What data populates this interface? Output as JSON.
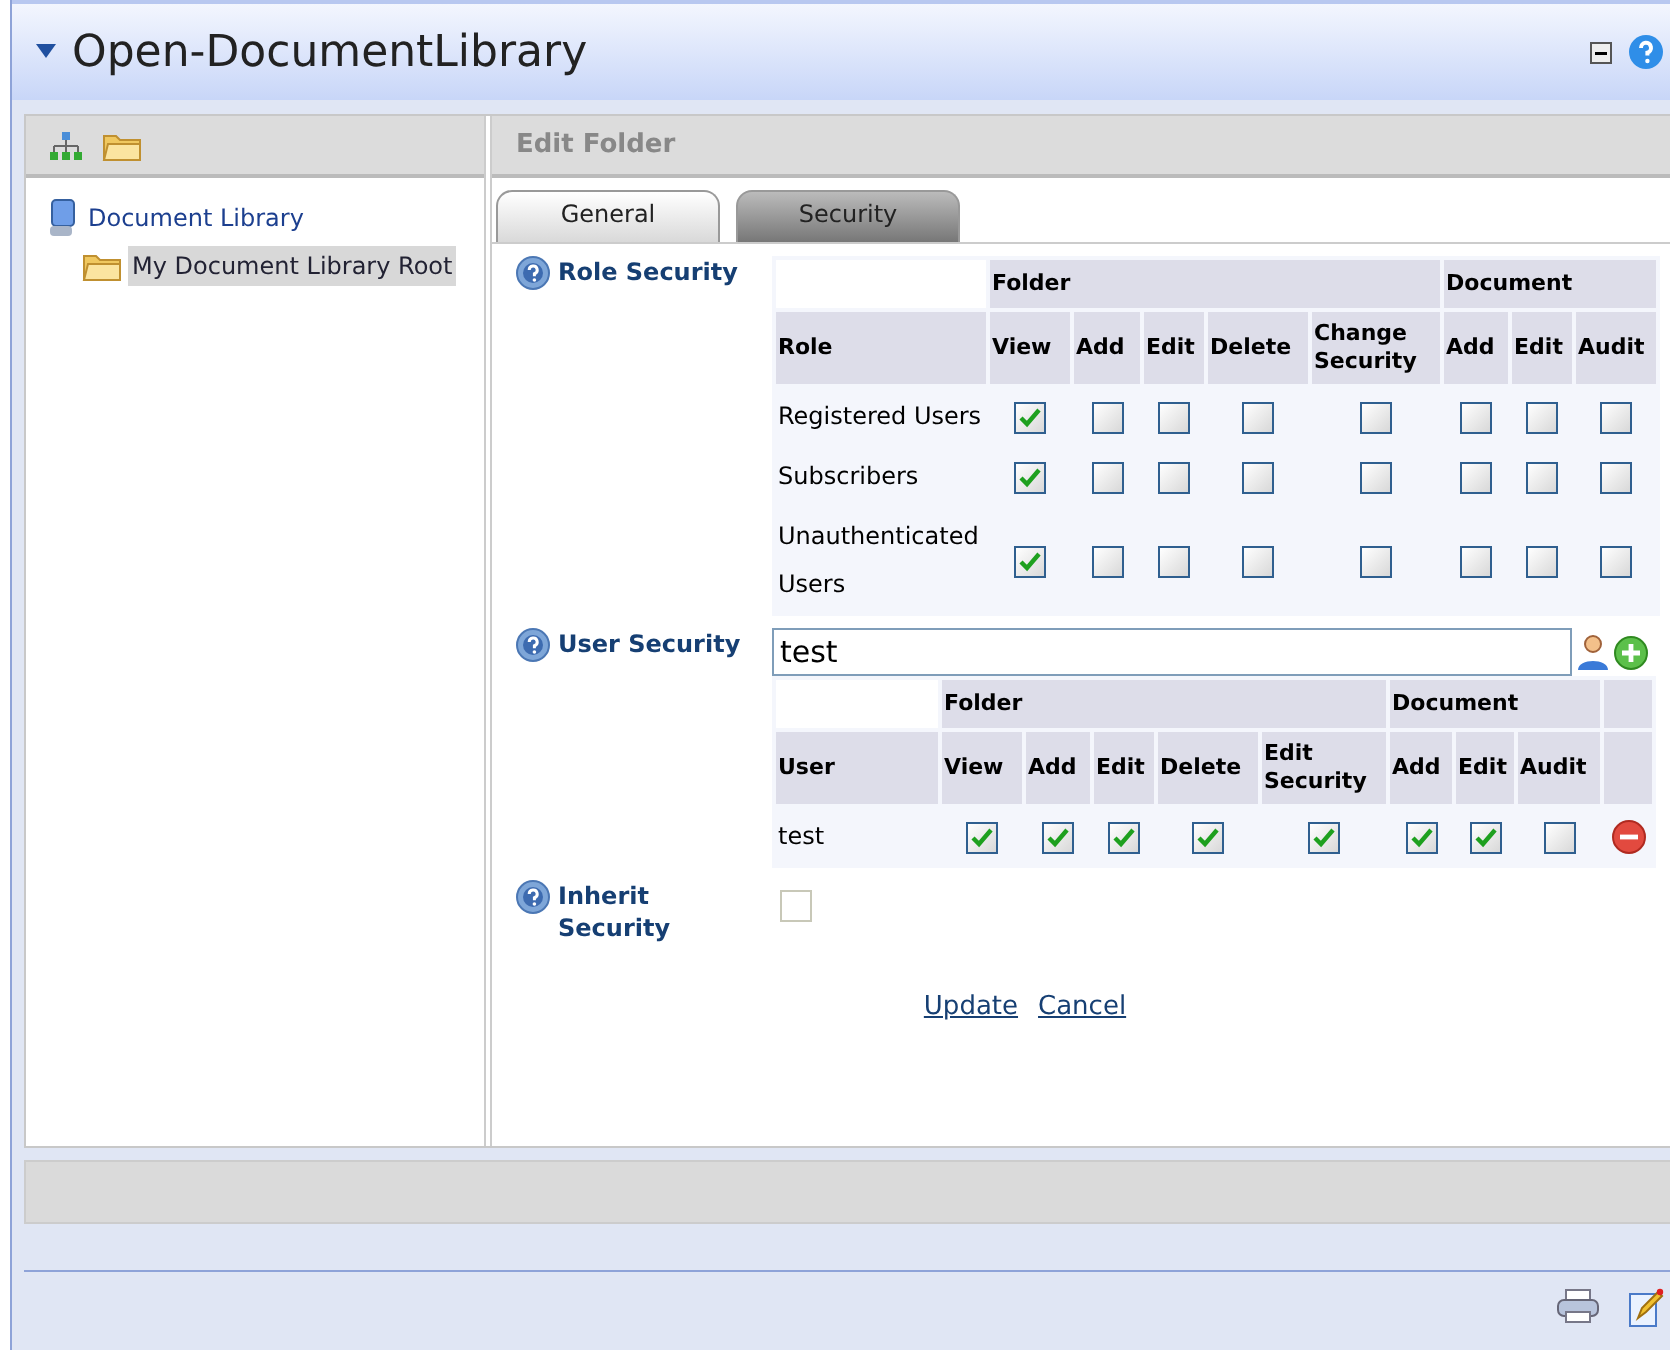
{
  "module": {
    "title": "Open-DocumentLibrary"
  },
  "tree": [
    {
      "label": "Document Library",
      "selected": false,
      "children": [
        {
          "label": "My Document Library Root",
          "selected": true
        }
      ]
    }
  ],
  "panel": {
    "title": "Edit Folder"
  },
  "tabs": [
    {
      "label": "General",
      "selected": false
    },
    {
      "label": "Security",
      "selected": true
    }
  ],
  "role_security": {
    "label": "Role Security",
    "first_column": "Role",
    "groups": [
      {
        "label": "Folder",
        "columns": [
          "View",
          "Add",
          "Edit",
          "Delete",
          "Change Security"
        ]
      },
      {
        "label": "Document",
        "columns": [
          "Add",
          "Edit",
          "Audit"
        ]
      }
    ],
    "rows": [
      {
        "name": "Registered Users",
        "checks": [
          {
            "checked": true
          },
          {
            "checked": false
          },
          {
            "checked": false
          },
          {
            "checked": false
          },
          {
            "checked": false
          },
          {
            "checked": false
          },
          {
            "checked": false
          },
          {
            "checked": false
          }
        ]
      },
      {
        "name": "Subscribers",
        "checks": [
          {
            "checked": true
          },
          {
            "checked": false
          },
          {
            "checked": false
          },
          {
            "checked": false
          },
          {
            "checked": false
          },
          {
            "checked": false
          },
          {
            "checked": false
          },
          {
            "checked": false
          }
        ]
      },
      {
        "name": "Unauthenticated Users",
        "checks": [
          {
            "checked": true
          },
          {
            "checked": false
          },
          {
            "checked": false
          },
          {
            "checked": false
          },
          {
            "checked": false
          },
          {
            "checked": false
          },
          {
            "checked": false
          },
          {
            "checked": false
          }
        ]
      }
    ]
  },
  "user_security": {
    "label": "User Security",
    "field_value": "test",
    "first_column": "User",
    "groups": [
      {
        "label": "Folder",
        "columns": [
          "View",
          "Add",
          "Edit",
          "Delete",
          "Edit Security"
        ]
      },
      {
        "label": "Document",
        "columns": [
          "Add",
          "Edit",
          "Audit"
        ]
      }
    ],
    "rows": [
      {
        "name": "test",
        "checks": [
          {
            "checked": true
          },
          {
            "checked": true
          },
          {
            "checked": true
          },
          {
            "checked": true
          },
          {
            "checked": true
          },
          {
            "checked": true
          },
          {
            "checked": true
          },
          {
            "checked": false
          }
        ]
      }
    ]
  },
  "inherit_security": {
    "label": "Inherit Security",
    "checked": false
  },
  "actions": [
    "Update",
    "Cancel"
  ]
}
